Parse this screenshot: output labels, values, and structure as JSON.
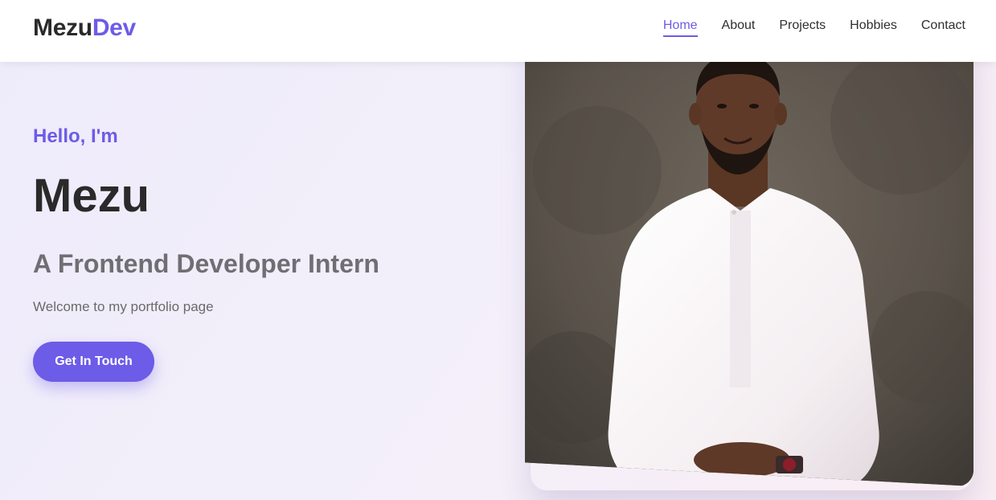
{
  "header": {
    "logo_main": "Mezu",
    "logo_accent": "Dev",
    "nav": [
      {
        "label": "Home",
        "active": true
      },
      {
        "label": "About",
        "active": false
      },
      {
        "label": "Projects",
        "active": false
      },
      {
        "label": "Hobbies",
        "active": false
      },
      {
        "label": "Contact",
        "active": false
      }
    ]
  },
  "hero": {
    "greeting": "Hello, I'm",
    "name": "Mezu",
    "role": "A Frontend Developer Intern",
    "welcome": "Welcome to my portfolio page",
    "cta_label": "Get In Touch"
  },
  "photo": {
    "icon": "portrait-photo"
  },
  "colors": {
    "accent": "#6c5ce7",
    "text_dark": "#2a2a2a",
    "text_muted": "#6f6f73"
  }
}
